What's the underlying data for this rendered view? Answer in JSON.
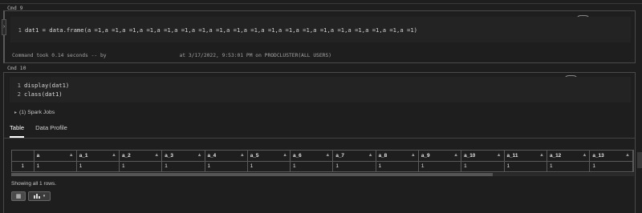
{
  "cells": [
    {
      "label": "Cmd 9",
      "lang": "R",
      "line_numbers": [
        "1"
      ],
      "code_lines": [
        "dat1 = data.frame(a =1,a =1,a =1,a =1,a =1,a =1,a =1,a =1,a =1,a =1,a =1,a =1,a =1,a =1,a =1,a =1,a =1,a =1,a =1)"
      ],
      "footer": "Command took 0.14 seconds -- by                        at 3/17/2022, 9:53:01 PM on PRODCLUSTER(ALL USERS)"
    },
    {
      "label": "Cmd 10",
      "lang": "R",
      "line_numbers": [
        "1",
        "2"
      ],
      "code_lines": [
        "display(dat1)",
        "class(dat1)"
      ],
      "spark_jobs": "(1) Spark Jobs",
      "tabs": [
        "Table",
        "Data Profile"
      ],
      "active_tab": "Table",
      "table": {
        "columns": [
          "a",
          "a_1",
          "a_2",
          "a_3",
          "a_4",
          "a_5",
          "a_6",
          "a_7",
          "a_8",
          "a_9",
          "a_10",
          "a_11",
          "a_12",
          "a_13"
        ],
        "rows": [
          {
            "index": "1",
            "values": [
              "1",
              "1",
              "1",
              "1",
              "1",
              "1",
              "1",
              "1",
              "1",
              "1",
              "1",
              "1",
              "1",
              "1"
            ]
          }
        ]
      },
      "showing": "Showing all 1 rows."
    }
  ],
  "icons": {
    "run": "play-icon",
    "chevron": "chevron-down-icon",
    "minimize": "minimize-icon",
    "close": "close-icon",
    "chart": "bar-chart-icon"
  },
  "colors": {
    "background": "#1e1e1e",
    "code_background": "#232323",
    "border": "#4a4a4a",
    "text": "#cfcfcf"
  }
}
